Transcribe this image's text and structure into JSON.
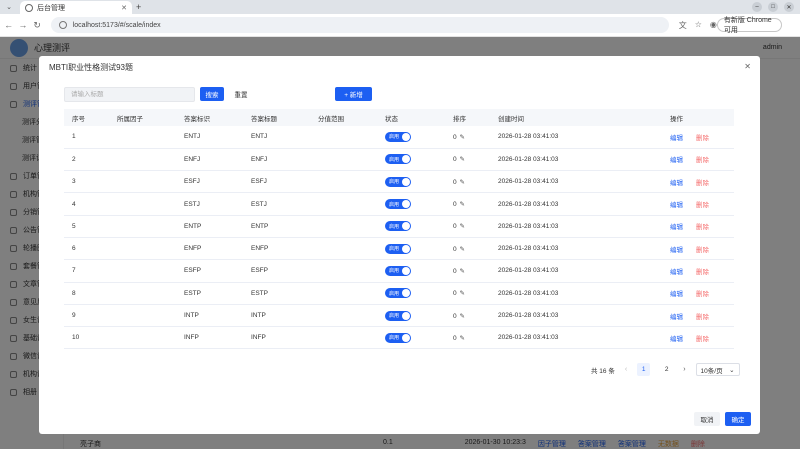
{
  "browser": {
    "tab_title": "后台管理",
    "url": "localhost:5173/#/scale/index",
    "update_label": "有新版 Chrome 可用"
  },
  "app": {
    "title": "心理测评",
    "user": "admin",
    "sidebar": [
      "统计",
      "用户管",
      "测评管",
      "测评分",
      "测评管",
      "测评记",
      "订单管",
      "机构管",
      "分销管",
      "公告管",
      "轮播图",
      "套餐管",
      "文章管",
      "意见反",
      "女生设",
      "基础设",
      "微信设",
      "机构设",
      "相册"
    ],
    "bg_row": {
      "name": "亮子商",
      "value": "0.1",
      "time": "2026-01-30 10:23:3",
      "links": [
        "因子管理",
        "答案管理",
        "答案管理"
      ],
      "warn": "无数据",
      "del": "删除"
    }
  },
  "dialog": {
    "title": "MBTI职业性格测试93题",
    "search_placeholder": "请输入标题",
    "search_label": "搜索",
    "reset_label": "重置",
    "add_label": "+ 新增",
    "columns": [
      "序号",
      "所属因子",
      "答案标识",
      "答案标题",
      "分值范围",
      "状态",
      "排序",
      "创建时间",
      "操作"
    ],
    "switch_label": "启用",
    "edit_label": "编辑",
    "delete_label": "删除",
    "rows": [
      {
        "no": "1",
        "factor": "",
        "mark": "ENTJ",
        "title": "ENTJ",
        "range": "",
        "sort": "0",
        "created": "2026-01-28 03:41:03"
      },
      {
        "no": "2",
        "factor": "",
        "mark": "ENFJ",
        "title": "ENFJ",
        "range": "",
        "sort": "0",
        "created": "2026-01-28 03:41:03"
      },
      {
        "no": "3",
        "factor": "",
        "mark": "ESFJ",
        "title": "ESFJ",
        "range": "",
        "sort": "0",
        "created": "2026-01-28 03:41:03"
      },
      {
        "no": "4",
        "factor": "",
        "mark": "ESTJ",
        "title": "ESTJ",
        "range": "",
        "sort": "0",
        "created": "2026-01-28 03:41:03"
      },
      {
        "no": "5",
        "factor": "",
        "mark": "ENTP",
        "title": "ENTP",
        "range": "",
        "sort": "0",
        "created": "2026-01-28 03:41:03"
      },
      {
        "no": "6",
        "factor": "",
        "mark": "ENFP",
        "title": "ENFP",
        "range": "",
        "sort": "0",
        "created": "2026-01-28 03:41:03"
      },
      {
        "no": "7",
        "factor": "",
        "mark": "ESFP",
        "title": "ESFP",
        "range": "",
        "sort": "0",
        "created": "2026-01-28 03:41:03"
      },
      {
        "no": "8",
        "factor": "",
        "mark": "ESTP",
        "title": "ESTP",
        "range": "",
        "sort": "0",
        "created": "2026-01-28 03:41:03"
      },
      {
        "no": "9",
        "factor": "",
        "mark": "INTP",
        "title": "INTP",
        "range": "",
        "sort": "0",
        "created": "2026-01-28 03:41:03"
      },
      {
        "no": "10",
        "factor": "",
        "mark": "INFP",
        "title": "INFP",
        "range": "",
        "sort": "0",
        "created": "2026-01-28 03:41:03"
      }
    ],
    "pagination": {
      "total": "共 16 条",
      "pages": [
        "1",
        "2"
      ],
      "current": "1",
      "size": "10条/页"
    },
    "cancel_label": "取消",
    "confirm_label": "确定"
  },
  "colors": {
    "primary": "#1d5ff2",
    "danger": "#f56c6c",
    "warning": "#e6a23c"
  }
}
